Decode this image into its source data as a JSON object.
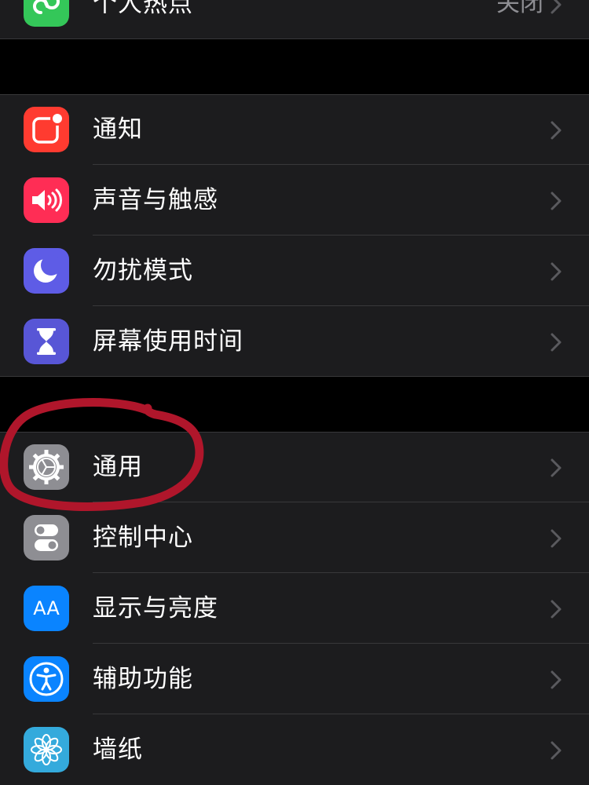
{
  "hotspot": {
    "label": "个人热点",
    "value": "关闭"
  },
  "group_notifications": {
    "items": [
      {
        "label": "通知"
      },
      {
        "label": "声音与触感"
      },
      {
        "label": "勿扰模式"
      },
      {
        "label": "屏幕使用时间"
      }
    ]
  },
  "group_general": {
    "items": [
      {
        "label": "通用"
      },
      {
        "label": "控制中心"
      },
      {
        "label": "显示与亮度"
      },
      {
        "label": "辅助功能"
      },
      {
        "label": "墙纸"
      }
    ]
  },
  "display_icon_text": "AA",
  "colors": {
    "hotspot": "#34c759",
    "notifications": "#ff3b30",
    "sounds": "#ff2d55",
    "dnd": "#5e5ce6",
    "screen_time": "#5856d6",
    "general": "#8e8e93",
    "control_center": "#8e8e93",
    "display": "#0a84ff",
    "accessibility": "#0a84ff",
    "wallpaper": "#34aadc",
    "annotation": "#b0162b"
  }
}
